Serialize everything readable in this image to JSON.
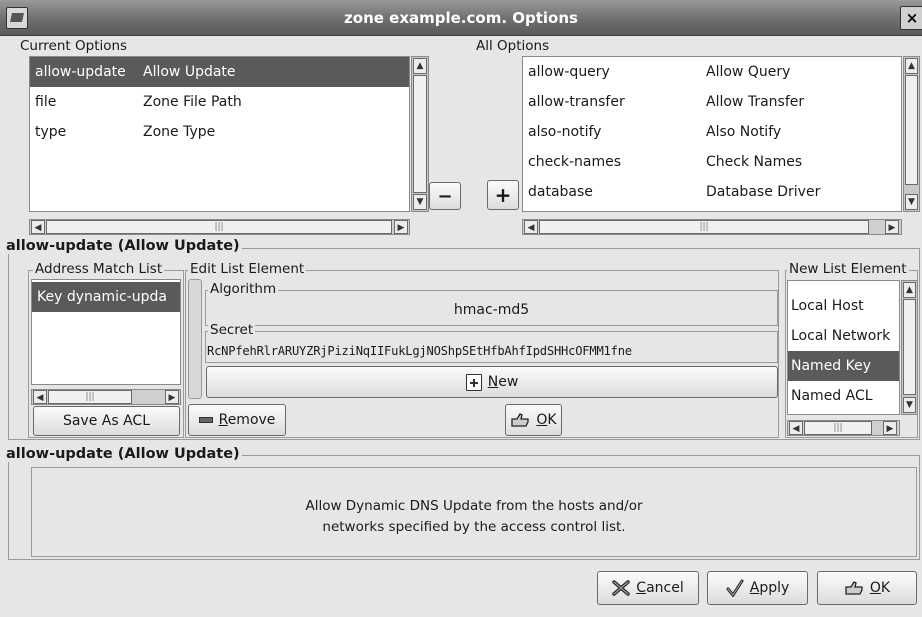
{
  "window": {
    "title": "zone example.com. Options",
    "close_glyph": "×"
  },
  "current_options": {
    "label": "Current Options",
    "rows": [
      {
        "name": "allow-update",
        "desc": "Allow Update",
        "selected": true
      },
      {
        "name": "file",
        "desc": "Zone File Path",
        "selected": false
      },
      {
        "name": "type",
        "desc": "Zone Type",
        "selected": false
      }
    ]
  },
  "all_options": {
    "label": "All Options",
    "rows": [
      {
        "name": "allow-query",
        "desc": "Allow Query"
      },
      {
        "name": "allow-transfer",
        "desc": "Allow Transfer"
      },
      {
        "name": "also-notify",
        "desc": "Also Notify"
      },
      {
        "name": "check-names",
        "desc": "Check Names"
      },
      {
        "name": "database",
        "desc": "Database Driver"
      }
    ]
  },
  "remove_glyph": "−",
  "add_glyph": "+",
  "option_editor": {
    "title": "allow-update (Allow Update)",
    "address_match_list": {
      "label": "Address Match List",
      "items": [
        "Key dynamic-upda"
      ],
      "save_acl": "Save As ACL"
    },
    "edit_list_element": {
      "label": "Edit List Element",
      "algorithm_label": "Algorithm",
      "algorithm_value": "hmac-md5",
      "secret_label": "Secret",
      "secret_value": "RcNPfehRlrARUYZRjPiziNqIIFukLgjNOShpSEtHfbAhfIpdSHHcOFMM1fne",
      "new_button": "New",
      "new_mnemonic": "N",
      "remove_button": "Remove",
      "remove_mnemonic": "R",
      "ok_button": "OK",
      "ok_mnemonic": "O"
    },
    "new_list_element": {
      "label": "New List Element",
      "items": [
        "Local Host",
        "Local Network",
        "Named Key",
        "Named ACL"
      ],
      "selected_index": 2
    }
  },
  "description": {
    "title": "allow-update (Allow Update)",
    "line1": "Allow Dynamic DNS Update from the hosts and/or",
    "line2": "networks specified by the access control list."
  },
  "footer": {
    "cancel": "Cancel",
    "cancel_mnemonic": "C",
    "apply": "Apply",
    "apply_mnemonic": "A",
    "ok": "OK",
    "ok_mnemonic": "O"
  },
  "scrollbar_glyphs": {
    "up": "▲",
    "down": "▼",
    "left": "◀",
    "right": "▶",
    "grip": "|||"
  },
  "icons": {
    "app": "dns-zone-icon",
    "cancel": "x-icon",
    "apply": "checkmark-icon",
    "ok": "hand-ok-icon",
    "new": "new-doc-icon",
    "remove": "minus-icon"
  }
}
